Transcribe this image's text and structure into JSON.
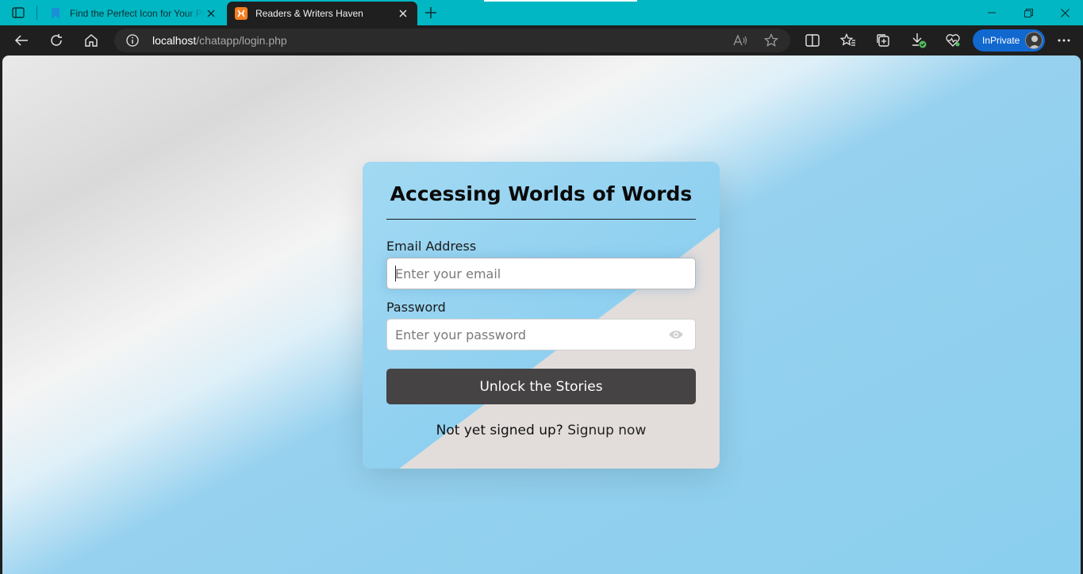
{
  "browser": {
    "tabs": [
      {
        "title": "Find the Perfect Icon for Your Project",
        "favicon": "bookmark-icon",
        "active": false
      },
      {
        "title": "Readers & Writers Haven",
        "favicon": "xampp-icon",
        "active": true
      }
    ],
    "address": {
      "host": "localhost",
      "path": "/chatapp/login.php"
    },
    "inprivate_label": "InPrivate",
    "accent": "#00b7c3"
  },
  "login": {
    "title": "Accessing Worlds of Words",
    "email_label": "Email Address",
    "email_placeholder": "Enter your email",
    "password_label": "Password",
    "password_placeholder": "Enter your password",
    "submit_label": "Unlock the Stories",
    "signup_prompt": "Not yet signed up?",
    "signup_link": "Signup now",
    "button_color": "#454343"
  }
}
